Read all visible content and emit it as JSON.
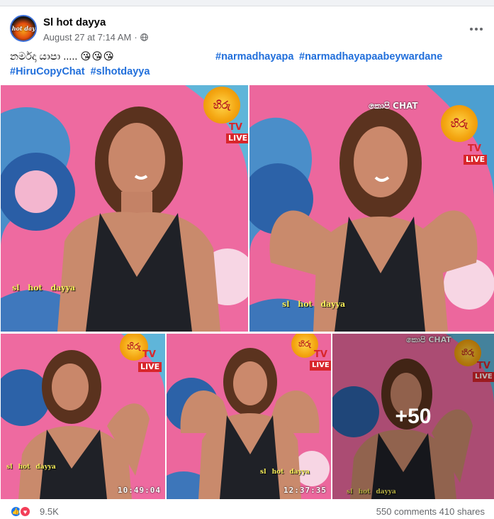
{
  "post": {
    "author": "Sl hot dayya",
    "avatar_text": "sl hot dayya",
    "date": "August 27 at 7:14 AM",
    "separator": "·",
    "privacy_icon": "globe-icon",
    "more_icon": "more-options-icon",
    "text_sinhala": "නර්මදා යාපා  .....",
    "text_emoji": "😘😘😘",
    "hashtags": [
      "#narmadhayapa",
      "#narmadhayapaabeywardane",
      "#HiruCopyChat",
      "#slhotdayya"
    ]
  },
  "photos": {
    "logo_text": "හිරු",
    "tv_text": "TV",
    "live_text": "LIVE",
    "show_text": "කොපි CHAT",
    "watermark": "sl hot dayya",
    "timestamps": [
      "10:49:04",
      "12:37:35"
    ],
    "more_count": "+50"
  },
  "footer": {
    "reactions": [
      "like-icon",
      "love-icon"
    ],
    "reaction_count": "9.5K",
    "stats": "550 comments  410 shares"
  },
  "colors": {
    "accent": "#216fdb",
    "muted": "#65676b",
    "background": "#f0f2f5"
  }
}
